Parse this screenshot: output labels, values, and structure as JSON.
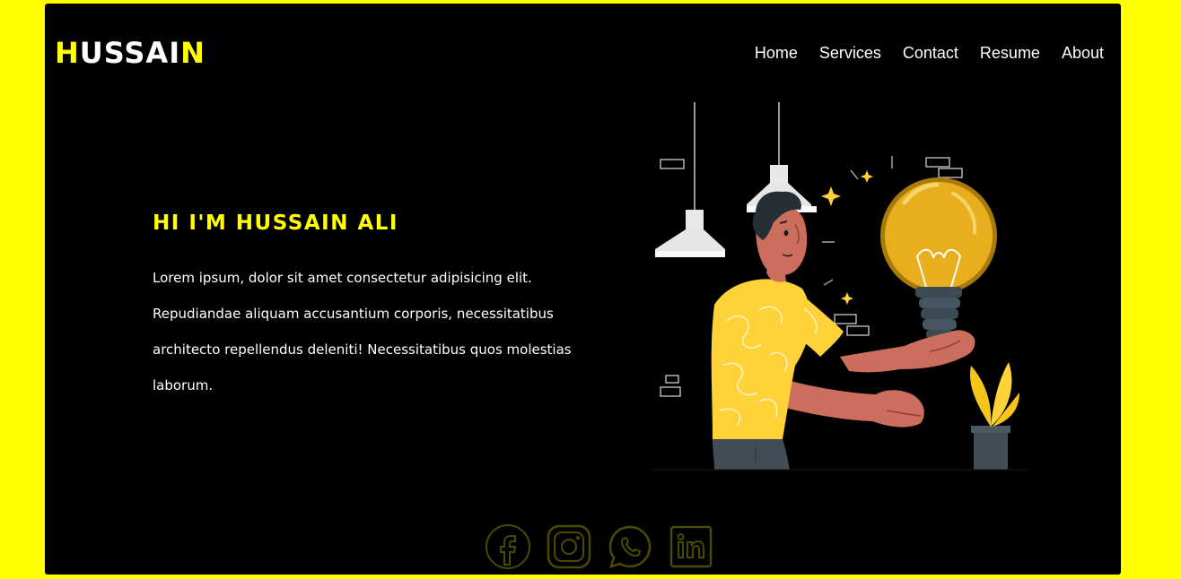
{
  "brand": {
    "first": "H",
    "middle": "USSAI",
    "last": "N"
  },
  "nav": {
    "items": [
      {
        "label": "Home"
      },
      {
        "label": "Services"
      },
      {
        "label": "Contact"
      },
      {
        "label": "Resume"
      },
      {
        "label": "About"
      }
    ]
  },
  "hero": {
    "title": "HI I'M HUSSAIN ALI",
    "text": "Lorem ipsum, dolor sit amet consectetur adipisicing elit. Repudiandae aliquam accusantium corporis, necessitatibus architecto repellendus deleniti! Necessitatibus quos molestias laborum."
  },
  "social": [
    "facebook-icon",
    "instagram-icon",
    "whatsapp-icon",
    "linkedin-icon"
  ],
  "colors": {
    "accent": "#ffff00",
    "background": "#000000",
    "text": "#ffffff"
  }
}
